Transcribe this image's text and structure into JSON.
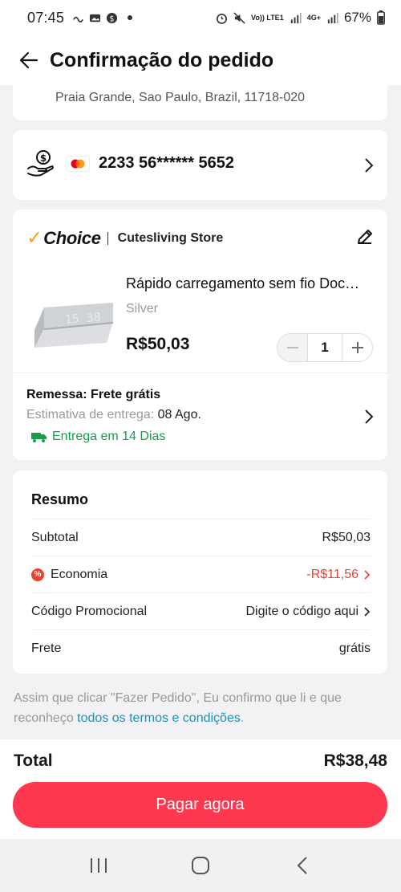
{
  "status_bar": {
    "time": "07:45",
    "battery": "67%",
    "volte": "Vo)) LTE1",
    "network": "4G+"
  },
  "header": {
    "title": "Confirmação do pedido"
  },
  "address": {
    "line": "Praia Grande, Sao Paulo, Brazil, 11718-020"
  },
  "payment": {
    "card_number": "2233 56****** 5652"
  },
  "product_card": {
    "badge": "Choice",
    "store": "Cutesliving Store",
    "title": "Rápido carregamento sem fio Doc…",
    "variant": "Silver",
    "price": "R$50,03",
    "quantity": "1",
    "shipping": "Remessa: Frete grátis",
    "eta_label": "Estimativa de entrega: ",
    "eta_date": "08 Ago.",
    "delivery": "Entrega em 14 Dias"
  },
  "summary": {
    "title": "Resumo",
    "rows": [
      {
        "label": "Subtotal",
        "value": "R$50,03"
      },
      {
        "label": "Economia",
        "value": "-R$11,56"
      },
      {
        "label": "Código Promocional",
        "value": "Digite o código aqui"
      },
      {
        "label": "Frete",
        "value": "grátis"
      }
    ]
  },
  "terms": {
    "text": "Assim que clicar \"Fazer Pedido\", Eu confirmo que li e que reconheço ",
    "link": "todos os termos e condições",
    "end": "."
  },
  "footer": {
    "total_label": "Total",
    "total_value": "R$38,48",
    "pay_button": "Pagar agora"
  },
  "colors": {
    "accent": "#fd384f",
    "green": "#1a9c4d",
    "red": "#e8432f",
    "link": "#1e8fb8"
  }
}
